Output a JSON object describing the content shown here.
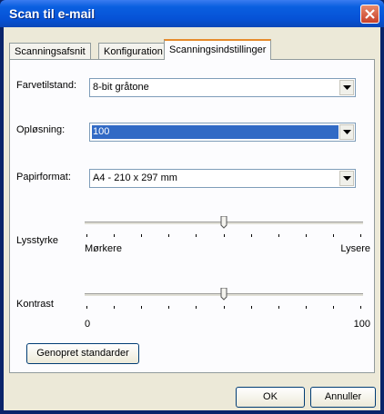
{
  "window": {
    "title": "Scan til e-mail"
  },
  "tabs": [
    {
      "label": "Scanningsafsnit"
    },
    {
      "label": "Konfiguration"
    },
    {
      "label": "Scanningsindstillinger"
    }
  ],
  "settings": {
    "color_mode": {
      "label": "Farvetilstand:",
      "value": "8-bit gråtone"
    },
    "resolution": {
      "label": "Opløsning:",
      "value": "100"
    },
    "paper_format": {
      "label": "Papirformat:",
      "value": "A4 - 210 x 297 mm"
    },
    "brightness": {
      "label": "Lysstyrke",
      "min_label": "Mørkere",
      "max_label": "Lysere",
      "value": 0.5
    },
    "contrast": {
      "label": "Kontrast",
      "min_label": "0",
      "max_label": "100",
      "value": 0.5
    }
  },
  "buttons": {
    "restore": "Genopret standarder",
    "ok": "OK",
    "cancel": "Annuller"
  }
}
